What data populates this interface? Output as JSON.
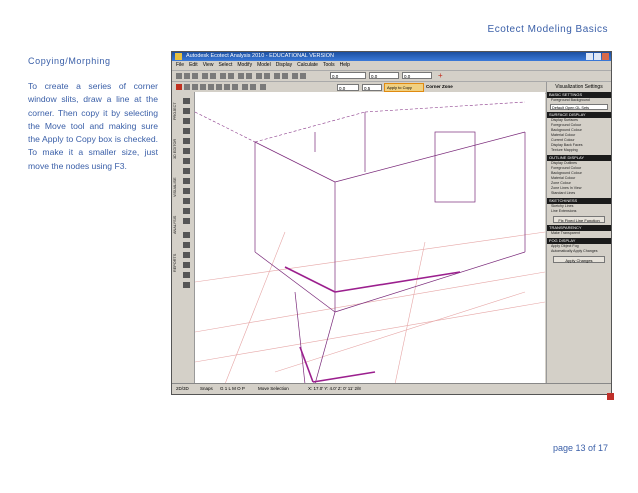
{
  "header": {
    "title": "Ecotect Modeling Basics"
  },
  "section": {
    "title": "Copying/Morphing"
  },
  "body_text": "To create a series of corner window slits, draw a line at the corner.  Then copy it by selecting the Move tool and making sure the Apply to Copy box is checked.  To make it a smaller size, just move the nodes using F3.",
  "footer": {
    "page": "page  13 of 17"
  },
  "app": {
    "window_title": "Autodesk Ecotect Analysis 2010 - EDUCATIONAL VERSION",
    "menu": [
      "File",
      "Edit",
      "View",
      "Select",
      "Modify",
      "Model",
      "Display",
      "Calculate",
      "Tools",
      "Help"
    ],
    "toolbar": {
      "field1": "0.0",
      "field2": "0.0",
      "field3": "0.0",
      "field4": "0.5",
      "apply_to_copy": "Apply to Copy",
      "corner_zone": "Corner Zone"
    },
    "side_tabs": [
      "PROJECT",
      "3D EDITOR",
      "VISUALISE",
      "ANALYSIS",
      "REPORTS"
    ],
    "panel": {
      "title": "Visualization Settings",
      "basic_settings": "BASIC SETTINGS",
      "foreground": "Foreground",
      "background": "Background",
      "default_preset": "Default Open GL Sets",
      "surface_display": "SURFACE DISPLAY",
      "surface_rows": [
        "Display Surfaces",
        "Foreground Colour",
        "Background Colour",
        "Material Colour",
        "Current Colour",
        "Display Back Faces",
        "Texture Mapping"
      ],
      "outline_display": "OUTLINE DISPLAY",
      "outline_rows": [
        "Display Outlines",
        "Foreground Colour",
        "Background Colour",
        "Material Colour",
        "Zone Colour",
        "Zone Lines In View",
        "Standard Lines"
      ],
      "sketchiness": "SKETCHINESS",
      "sketchiness_rows": [
        "Sketchy Lines",
        "Line Extensions"
      ],
      "fixed_line_function": "Fix Fixed Line Function",
      "transparency": "TRANSPARENCY",
      "transparency_rows": [
        "Make Transparent"
      ],
      "fog_display": "FOG DISPLAY",
      "fog_rows": [
        "Apply Object Fog"
      ],
      "auto_apply": "Automatically Apply Changes",
      "apply_changes": "Apply Changes"
    },
    "status": {
      "left": "2D/3D",
      "snaps_label": "Snaps",
      "snaps": "G 1 L M O P",
      "mode": "Move Selection",
      "coords": "X: 17.0'  Y: 4.0'  Z: 0'  11' 2/8"
    }
  },
  "colors": {
    "text_blue": "#3a5fa8",
    "selection": "#9b1f8e"
  }
}
